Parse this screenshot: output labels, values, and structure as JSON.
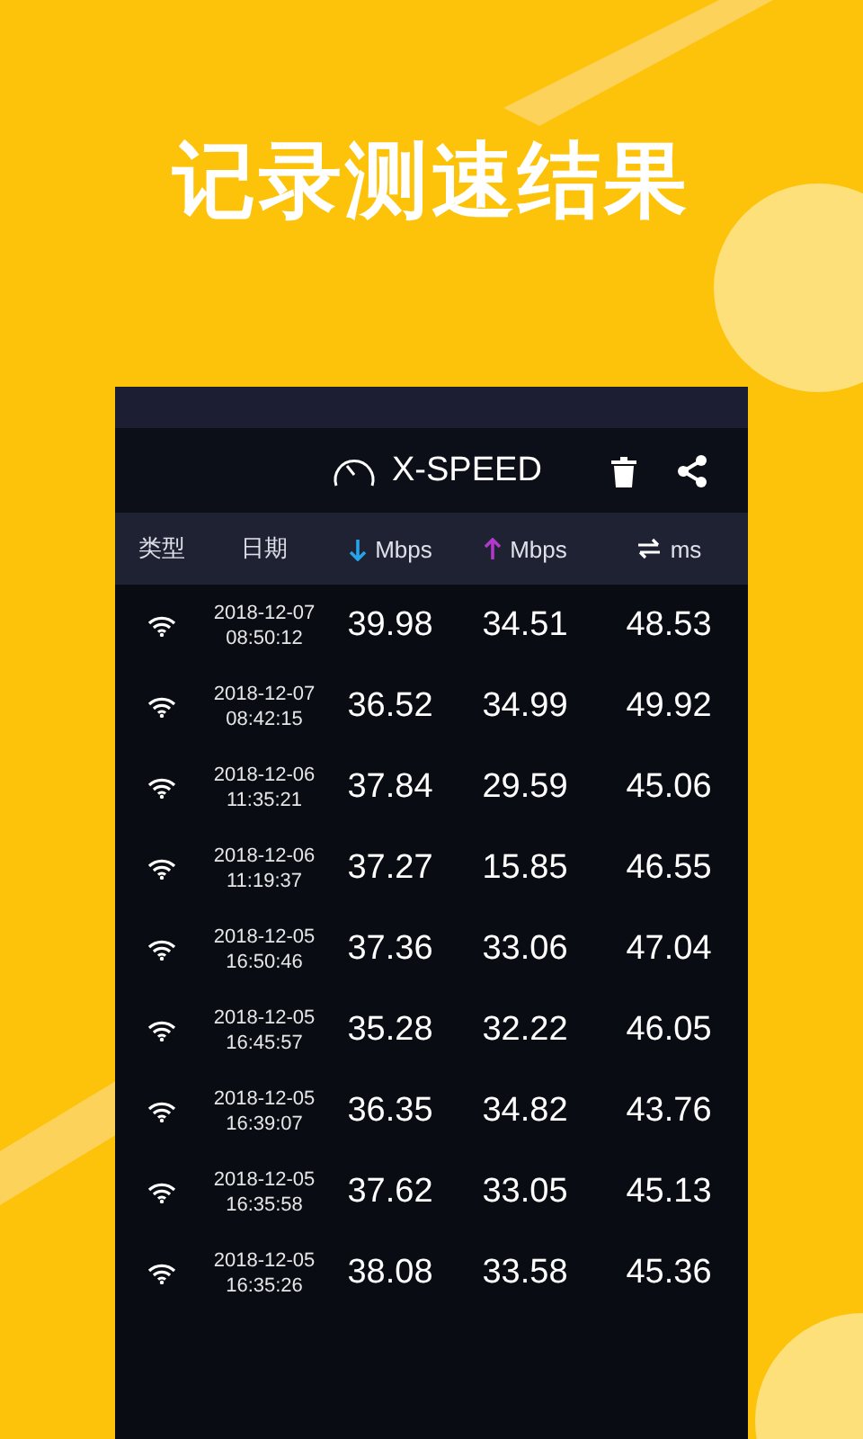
{
  "headline": "记录测速结果",
  "app": {
    "title": "X-SPEED"
  },
  "table": {
    "columns": [
      {
        "kind": "plain",
        "label": "类型"
      },
      {
        "kind": "plain",
        "label": "日期"
      },
      {
        "kind": "download",
        "label": "Mbps"
      },
      {
        "kind": "upload",
        "label": "Mbps"
      },
      {
        "kind": "ping",
        "label": "ms"
      }
    ],
    "rows": [
      {
        "kind": "wifi",
        "date": "2018-12-07",
        "time": "08:50:12",
        "download": "39.98",
        "upload": "34.51",
        "ping": "48.53"
      },
      {
        "kind": "wifi",
        "date": "2018-12-07",
        "time": "08:42:15",
        "download": "36.52",
        "upload": "34.99",
        "ping": "49.92"
      },
      {
        "kind": "wifi",
        "date": "2018-12-06",
        "time": "11:35:21",
        "download": "37.84",
        "upload": "29.59",
        "ping": "45.06"
      },
      {
        "kind": "wifi",
        "date": "2018-12-06",
        "time": "11:19:37",
        "download": "37.27",
        "upload": "15.85",
        "ping": "46.55"
      },
      {
        "kind": "wifi",
        "date": "2018-12-05",
        "time": "16:50:46",
        "download": "37.36",
        "upload": "33.06",
        "ping": "47.04"
      },
      {
        "kind": "wifi",
        "date": "2018-12-05",
        "time": "16:45:57",
        "download": "35.28",
        "upload": "32.22",
        "ping": "46.05"
      },
      {
        "kind": "wifi",
        "date": "2018-12-05",
        "time": "16:39:07",
        "download": "36.35",
        "upload": "34.82",
        "ping": "43.76"
      },
      {
        "kind": "wifi",
        "date": "2018-12-05",
        "time": "16:35:58",
        "download": "37.62",
        "upload": "33.05",
        "ping": "45.13"
      },
      {
        "kind": "wifi",
        "date": "2018-12-05",
        "time": "16:35:26",
        "download": "38.08",
        "upload": "33.58",
        "ping": "45.36"
      }
    ]
  }
}
